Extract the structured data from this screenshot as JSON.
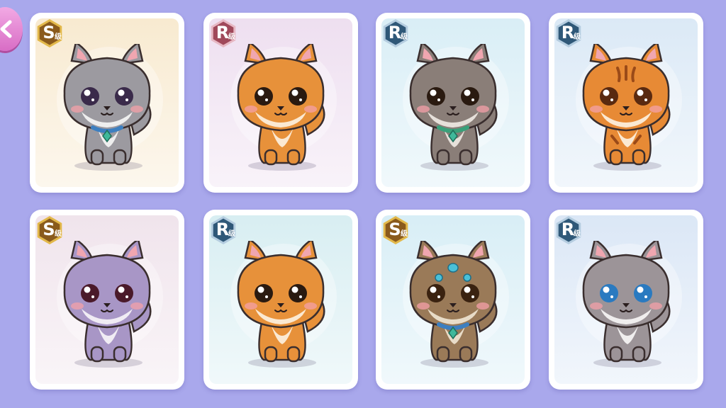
{
  "colors": {
    "background": "#a9a8ec",
    "back_button": "#e08bd2",
    "rank_s": "#8a5a1c",
    "rank_s_rim": "#e2b84a",
    "rank_r_rose": "#a0485a",
    "rank_r_blue": "#2f5878"
  },
  "back_button": {
    "icon": "chevron-left-icon"
  },
  "pets": [
    {
      "rank": "S",
      "rank_suffix": "级",
      "badge_color": "#8a5a1c",
      "badge_rim": "#e2b84a",
      "card_bg": "#f8ead0",
      "species": "gray wolf pup",
      "fur": "#9c9aa0",
      "fur_dark": "#6e6c74",
      "belly": "#eeeeee",
      "eye": "#3a2a4a",
      "collar": "#3d7fc0",
      "stripes": false
    },
    {
      "rank": "R",
      "rank_suffix": "级",
      "badge_color": "#a0485a",
      "badge_rim": "#e7b8c4",
      "card_bg": "#eedff0",
      "species": "orange fox pup",
      "fur": "#e7913a",
      "fur_dark": "#b86420",
      "belly": "#fbe9d2",
      "eye": "#2a1a10",
      "collar": "",
      "stripes": false
    },
    {
      "rank": "R",
      "rank_suffix": "级",
      "badge_color": "#2f5878",
      "badge_rim": "#b5cde0",
      "card_bg": "#d9eef6",
      "species": "brown wolf pup",
      "fur": "#8a7e78",
      "fur_dark": "#5f5550",
      "belly": "#e6e0da",
      "eye": "#2a1a10",
      "collar": "#3aa07a",
      "stripes": false
    },
    {
      "rank": "R",
      "rank_suffix": "级",
      "badge_color": "#2f5878",
      "badge_rim": "#b5cde0",
      "card_bg": "#dbe9f6",
      "species": "tabby cat",
      "fur": "#e78a35",
      "fur_dark": "#9a4a18",
      "belly": "#fbe9d2",
      "eye": "#5a2a10",
      "collar": "",
      "stripes": true
    },
    {
      "rank": "S",
      "rank_suffix": "级",
      "badge_color": "#8a5a1c",
      "badge_rim": "#e2b84a",
      "card_bg": "#f0e4ec",
      "species": "lavender wolf pup",
      "fur": "#a896c6",
      "fur_dark": "#6c5c8c",
      "belly": "#f0ecf4",
      "eye": "#4a1a2a",
      "collar": "",
      "stripes": false
    },
    {
      "rank": "R",
      "rank_suffix": "级",
      "badge_color": "#2f5878",
      "badge_rim": "#b5cde0",
      "card_bg": "#d8eef2",
      "species": "orange fox pup",
      "fur": "#e7913a",
      "fur_dark": "#b86420",
      "belly": "#fbe9d2",
      "eye": "#2a1a10",
      "collar": "",
      "stripes": false
    },
    {
      "rank": "S",
      "rank_suffix": "级",
      "badge_color": "#8a5a1c",
      "badge_rim": "#e2b84a",
      "card_bg": "#d8eef6",
      "species": "brown pup with blue gems",
      "fur": "#9a7a58",
      "fur_dark": "#5e4430",
      "belly": "#e8dcc8",
      "eye": "#3a2210",
      "collar": "#3d7fc0",
      "stripes": false
    },
    {
      "rank": "R",
      "rank_suffix": "级",
      "badge_color": "#2f5878",
      "badge_rim": "#b5cde0",
      "card_bg": "#dbe7f6",
      "species": "gray blue-eyed wolf pup",
      "fur": "#9c9498",
      "fur_dark": "#5e5658",
      "belly": "#f0eeee",
      "eye": "#2a7ac0",
      "collar": "",
      "stripes": false
    }
  ]
}
